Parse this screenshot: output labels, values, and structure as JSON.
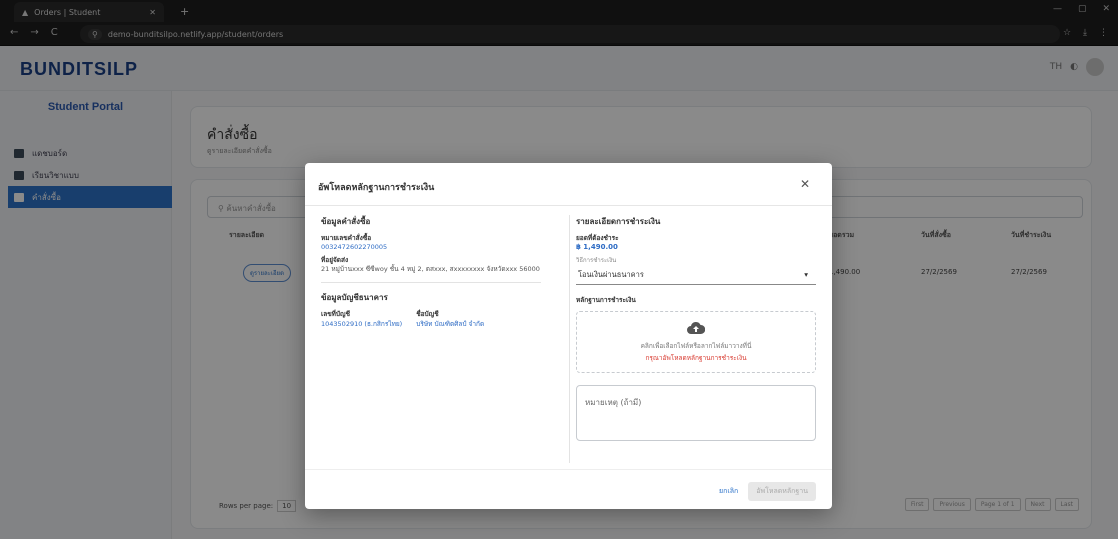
{
  "browser": {
    "tab_title": "Orders | Student",
    "url_site": "⚲",
    "url": "demo-bunditsilpo.netlify.app/student/orders"
  },
  "app": {
    "brand": "BUNDITSILP",
    "lang": "TH"
  },
  "sidebar": {
    "portal_title": "Student Portal",
    "items": [
      {
        "label": "แดชบอร์ด"
      },
      {
        "label": "เรียนวิชาแบบ"
      },
      {
        "label": "คำสั่งซื้อ"
      }
    ]
  },
  "page": {
    "title": "คำสั่งซื้อ",
    "subtitle": "ดูรายละเอียดคำสั่งซื้อ",
    "search_placeholder": "ค้นหาคำสั่งซื้อ",
    "columns": [
      "รายละเอียด",
      "ยอดรวม",
      "วันที่สั่งซื้อ",
      "วันที่ชำระเงิน"
    ],
    "row": {
      "status": "ดูรายละเอียด",
      "total": "1,490.00",
      "order_date": "27/2/2569",
      "pay_date": "27/2/2569"
    },
    "rows_per_page_label": "Rows per page:",
    "rows_per_page": "10",
    "pager": [
      "First",
      "Previous",
      "Page 1 of 1",
      "Next",
      "Last"
    ]
  },
  "modal": {
    "title": "อัพโหลดหลักฐานการชำระเงิน",
    "close": "✕",
    "left": {
      "order_section": "ข้อมูลคำสั่งซื้อ",
      "order_no_label": "หมายเลขคำสั่งซื้อ",
      "order_no": "0032472602270005",
      "address_label": "ที่อยู่จัดส่ง",
      "address": "21 หมู่บ้านxxx ซีซีwoy ชั้น 4 หมู่ 2, ตสxxx, สxxxxxxxx จังหวัดxxx 56000",
      "bank_section": "ข้อมูลบัญชีธนาคาร",
      "acc_no_label": "เลขที่บัญชี",
      "acc_no": "1043502910 (ธ.กสิกรไทย)",
      "acc_name_label": "ชื่อบัญชี",
      "acc_name": "บริษัท บัณฑิตศิลป์ จำกัด"
    },
    "right": {
      "pay_section": "รายละเอียดการชำระเงิน",
      "amount_label": "ยอดที่ต้องชำระ",
      "amount": "฿ 1,490.00",
      "method_label": "วิธีการชำระเงิน",
      "method": "โอนเงินผ่านธนาคาร",
      "proof_label": "หลักฐานการชำระเงิน",
      "upload_text": "คลิกเพื่อเลือกไฟล์หรือลากไฟล์มาวางที่นี่",
      "upload_warn": "กรุณาอัพโหลดหลักฐานการชำระเงิน",
      "note_placeholder": "หมายเหตุ (ถ้ามี)"
    },
    "cancel": "ยกเลิก",
    "confirm": "อัพโหลดหลักฐาน"
  }
}
